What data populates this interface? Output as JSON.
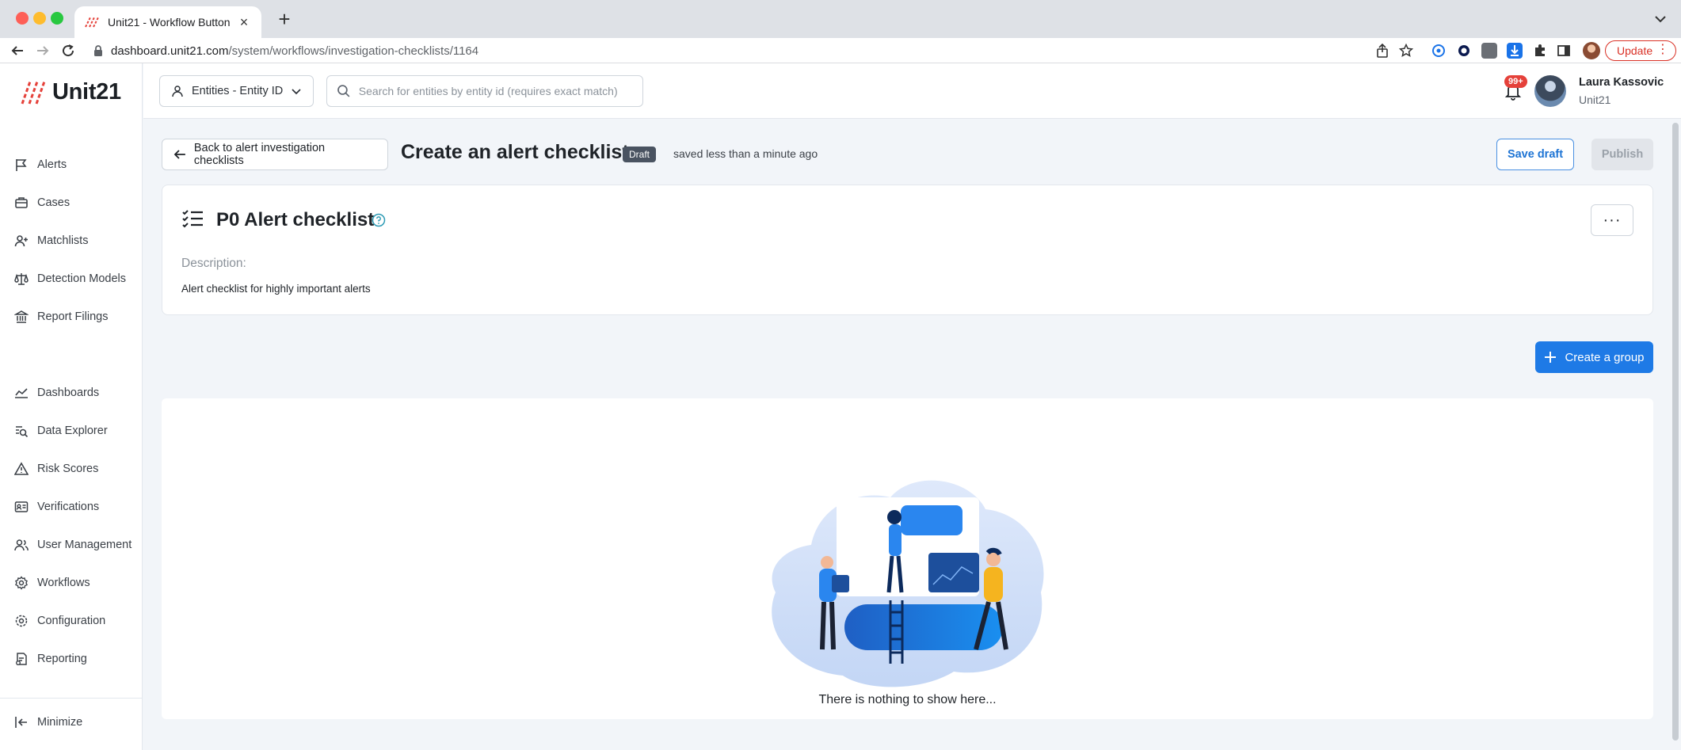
{
  "browser": {
    "tab_title": "Unit21 - Workflow Button",
    "url_host": "dashboard.unit21.com",
    "url_path": "/system/workflows/investigation-checklists/1164",
    "update_label": "Update"
  },
  "app": {
    "logo_text": "Unit21",
    "brand_color": "#e5413a",
    "accent_color": "#1e7ae6"
  },
  "sidebar": {
    "items": [
      {
        "label": "Alerts",
        "icon": "flag-icon"
      },
      {
        "label": "Cases",
        "icon": "briefcase-icon"
      },
      {
        "label": "Matchlists",
        "icon": "user-plus-icon"
      },
      {
        "label": "Detection Models",
        "icon": "scale-icon"
      },
      {
        "label": "Report Filings",
        "icon": "bank-icon"
      },
      {
        "label": "Dashboards",
        "icon": "line-chart-icon"
      },
      {
        "label": "Data Explorer",
        "icon": "search-doc-icon"
      },
      {
        "label": "Risk Scores",
        "icon": "warning-icon"
      },
      {
        "label": "Verifications",
        "icon": "id-card-icon"
      },
      {
        "label": "User Management",
        "icon": "users-icon"
      },
      {
        "label": "Workflows",
        "icon": "gear-icon"
      },
      {
        "label": "Configuration",
        "icon": "gear-icon"
      },
      {
        "label": "Reporting",
        "icon": "report-icon"
      }
    ],
    "minimize_label": "Minimize"
  },
  "topbar": {
    "entity_select": "Entities - Entity ID",
    "search_placeholder": "Search for entities by entity id (requires exact match)",
    "notification_count": "99+",
    "user_name": "Laura Kassovic",
    "user_org": "Unit21"
  },
  "header": {
    "back_label": "Back to alert investigation checklists",
    "title": "Create an alert checklist",
    "status_badge": "Draft",
    "saved_text": "saved less than a minute ago",
    "save_draft_label": "Save draft",
    "publish_label": "Publish"
  },
  "checklist": {
    "name": "P0 Alert checklist",
    "description_label": "Description:",
    "description": "Alert checklist for highly important alerts",
    "more_label": "···"
  },
  "groups": {
    "create_label": "Create a group",
    "empty_text": "There is nothing to show here..."
  }
}
